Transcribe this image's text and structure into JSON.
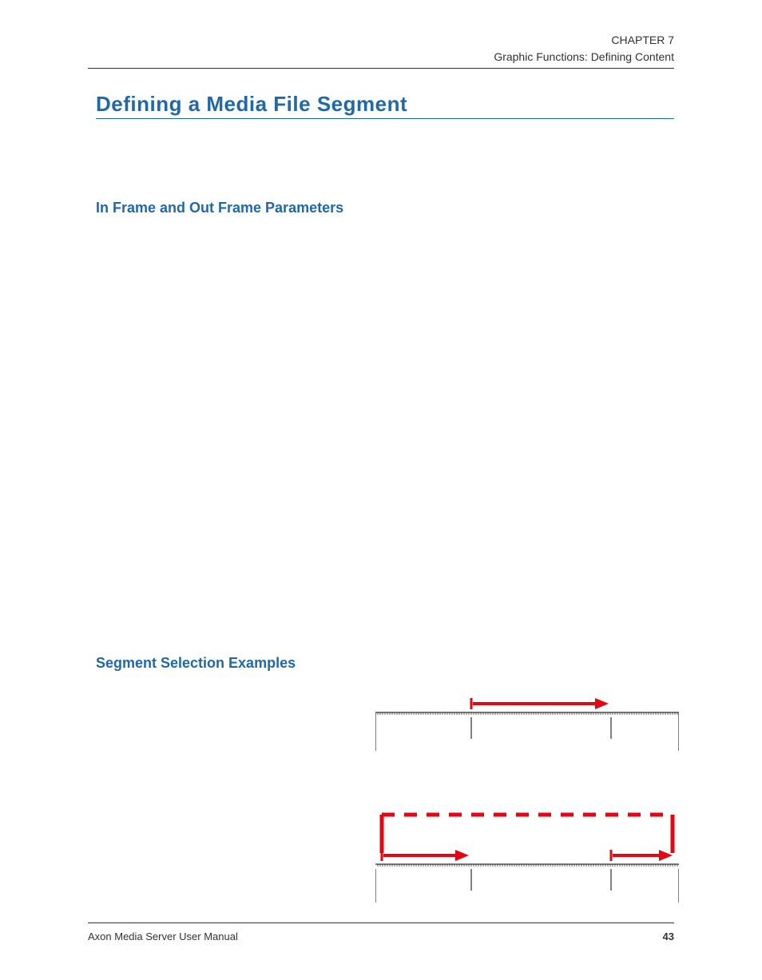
{
  "header": {
    "chapter": "CHAPTER 7",
    "section": "Graphic Functions: Defining Content"
  },
  "headings": {
    "main": "Defining a Media File Segment",
    "sub1": "In Frame and Out Frame Parameters",
    "sub2": "Segment Selection Examples"
  },
  "footer": {
    "manual": "Axon Media Server User Manual",
    "page": "43"
  },
  "colors": {
    "heading_blue": "#2068a8",
    "arrow_red": "#e30613",
    "text_gray": "#333333"
  }
}
